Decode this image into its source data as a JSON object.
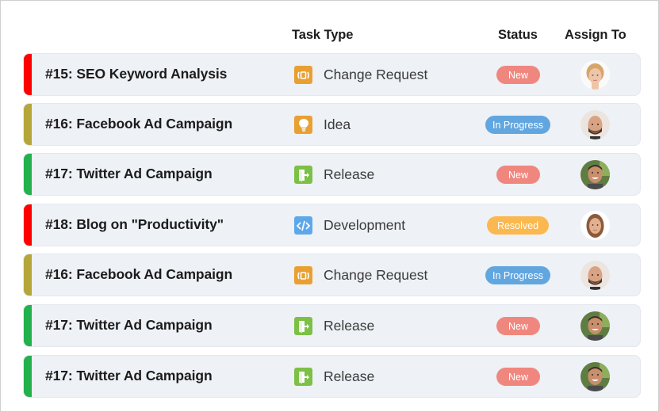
{
  "header": {
    "task_type": "Task Type",
    "status": "Status",
    "assign_to": "Assign To"
  },
  "colors": {
    "priority_high": "#ff0000",
    "priority_medium": "#b5a639",
    "priority_low": "#22b14c",
    "status_new": "#f0877f",
    "status_in_progress": "#62a6e0",
    "status_resolved": "#fbb84f",
    "type_change_request": "#e9a032",
    "type_idea": "#e9a032",
    "type_release": "#7cc047",
    "type_development": "#5ea8ea",
    "row_bg": "#eef1f5"
  },
  "rows": [
    {
      "title": "#15: SEO Keyword Analysis",
      "priority": "high",
      "task_type": "Change Request",
      "type_icon": "change-request-icon",
      "status": "New",
      "status_key": "new",
      "assignee": "woman-blonde-avatar"
    },
    {
      "title": "#16: Facebook Ad Campaign",
      "priority": "medium",
      "task_type": "Idea",
      "type_icon": "lightbulb-icon",
      "status": "In Progress",
      "status_key": "progress",
      "assignee": "man-bearded-avatar"
    },
    {
      "title": "#17: Twitter Ad Campaign",
      "priority": "low",
      "task_type": "Release",
      "type_icon": "release-door-icon",
      "status": "New",
      "status_key": "new",
      "assignee": "man-smiling-avatar"
    },
    {
      "title": "#18: Blog on \"Productivity\"",
      "priority": "high",
      "task_type": "Development",
      "type_icon": "code-icon",
      "status": "Resolved",
      "status_key": "resolved",
      "assignee": "woman-brunette-avatar"
    },
    {
      "title": "#16: Facebook Ad Campaign",
      "priority": "medium",
      "task_type": "Change Request",
      "type_icon": "change-request-icon",
      "status": "In Progress",
      "status_key": "progress",
      "assignee": "man-bearded-avatar"
    },
    {
      "title": "#17: Twitter Ad Campaign",
      "priority": "low",
      "task_type": "Release",
      "type_icon": "release-door-icon",
      "status": "New",
      "status_key": "new",
      "assignee": "man-smiling-avatar"
    },
    {
      "title": "#17: Twitter Ad Campaign",
      "priority": "low",
      "task_type": "Release",
      "type_icon": "release-door-icon",
      "status": "New",
      "status_key": "new",
      "assignee": "man-smiling-avatar"
    }
  ]
}
